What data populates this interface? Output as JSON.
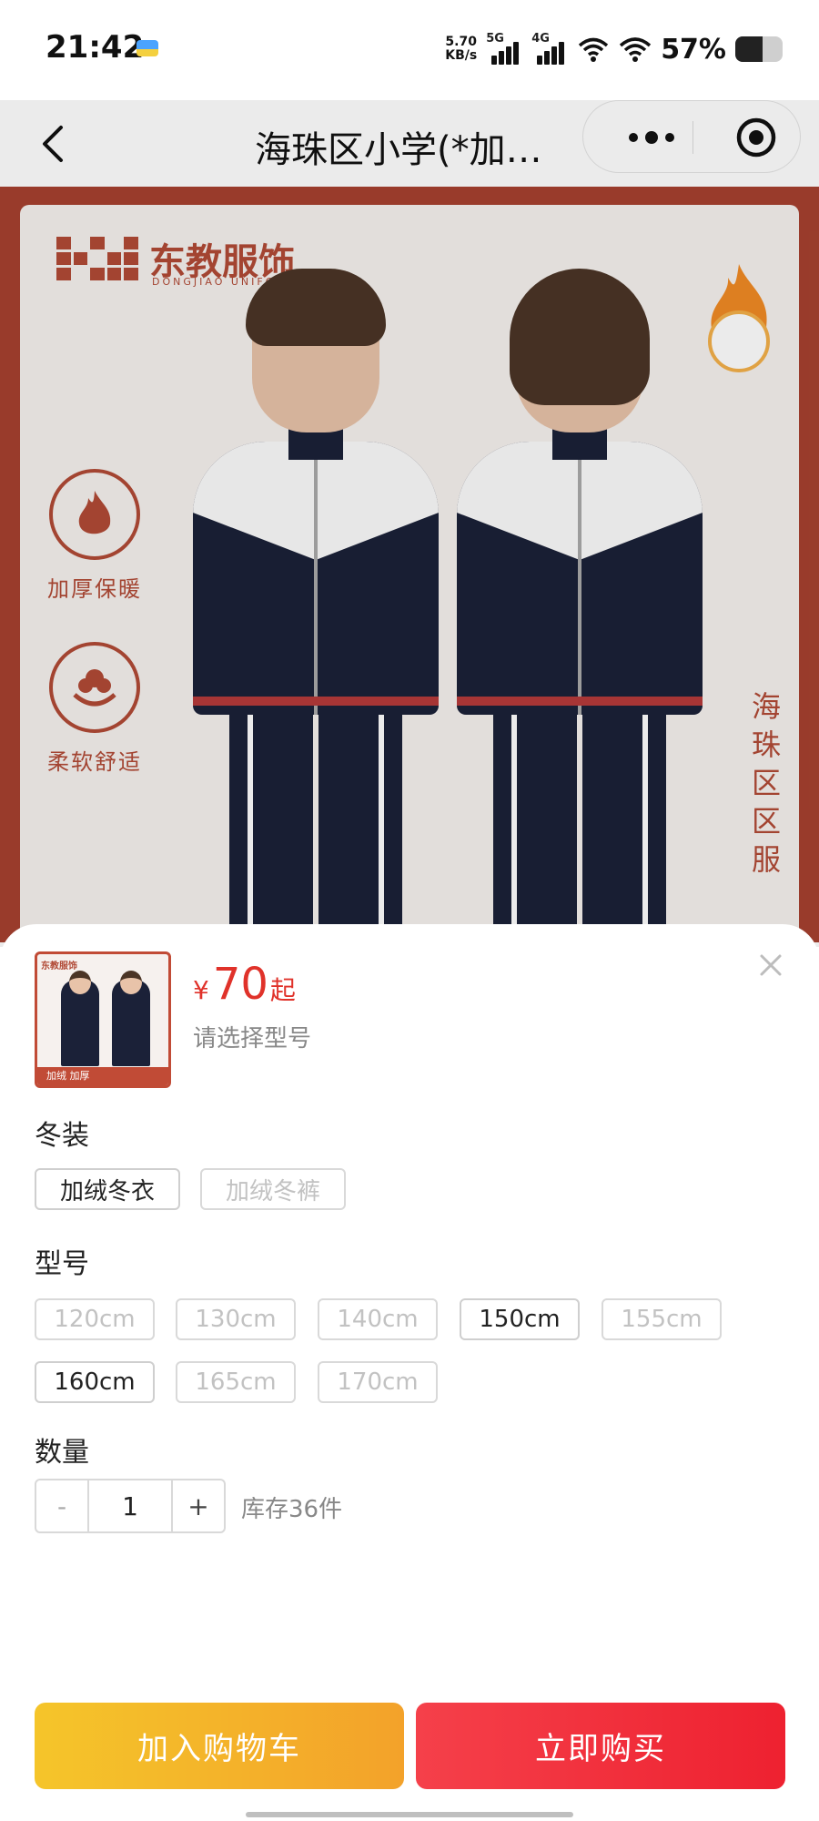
{
  "status_bar": {
    "time": "21:42",
    "net_speed_value": "5.70",
    "net_speed_unit": "KB/s",
    "sim1_label": "5G",
    "sim2_label": "4G",
    "battery_percent": "57%",
    "battery_level": 0.57
  },
  "nav": {
    "title": "海珠区小学(*加…"
  },
  "banner": {
    "brand_name": "东教服饰",
    "brand_sub": "DONGJIAO UNIFORM",
    "feature_1": "加厚保暖",
    "feature_2": "柔软舒适",
    "side_text": "海珠区区服"
  },
  "sheet": {
    "thumb_brand": "东教服饰",
    "thumb_bar": "加绒  加厚",
    "price_symbol": "¥",
    "price_value": "70",
    "price_suffix": "起",
    "select_hint": "请选择型号",
    "season_label": "冬装",
    "season_options": [
      "加绒冬衣",
      "加绒冬裤"
    ],
    "size_label": "型号",
    "size_options": [
      "120cm",
      "130cm",
      "140cm",
      "150cm",
      "155cm",
      "160cm",
      "165cm",
      "170cm"
    ],
    "quantity_label": "数量",
    "quantity_minus": "-",
    "quantity_value": "1",
    "quantity_plus": "+",
    "stock_text": "库存36件",
    "add_to_cart": "加入购物车",
    "buy_now": "立即购买"
  },
  "colors": {
    "price": "#e0322a",
    "brand": "#b14a36",
    "cart_button": "#f3a22a",
    "buy_button": "#ee2130"
  }
}
